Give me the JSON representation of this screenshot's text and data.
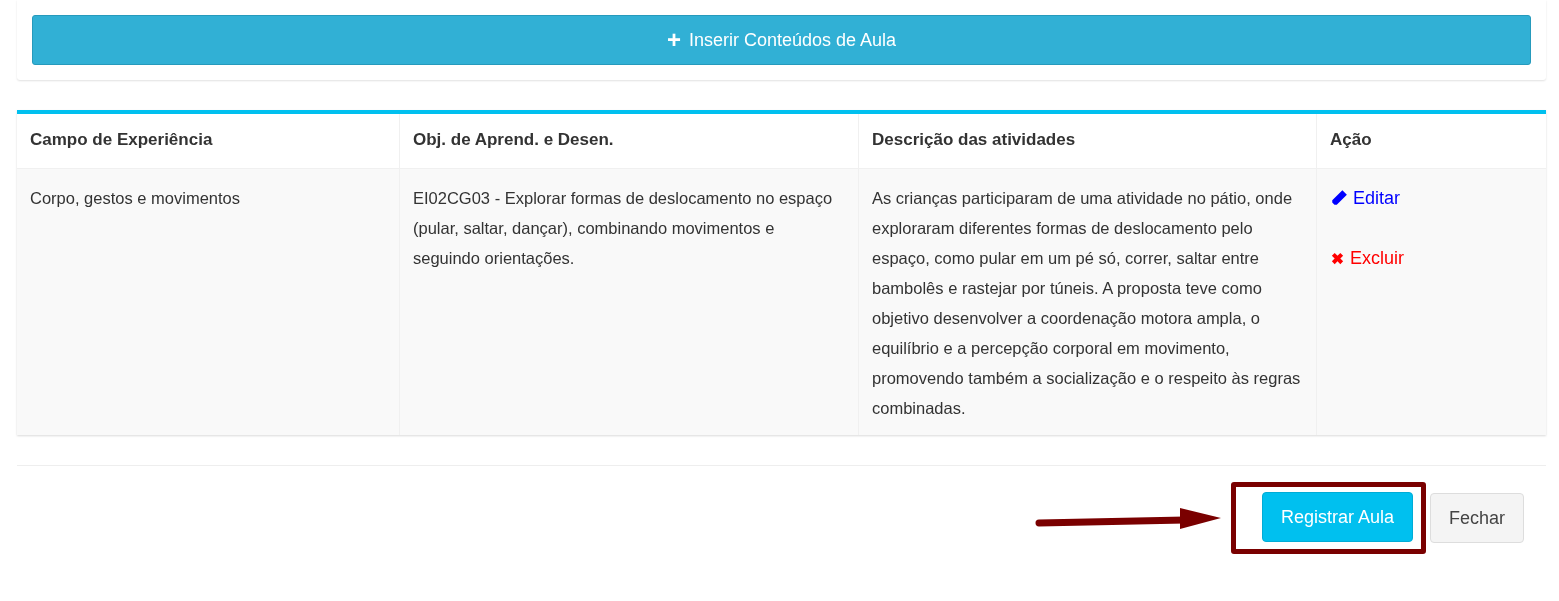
{
  "insert_button": {
    "icon": "+",
    "label": "Inserir Conteúdos de Aula"
  },
  "table": {
    "columns": [
      "Campo de Experiência",
      "Obj. de Aprend. e Desen.",
      "Descrição das atividades",
      "Ação"
    ],
    "rows": [
      {
        "cells": [
          "Corpo, gestos e movimentos",
          "EI02CG03 - Explorar formas de deslocamento no espaço (pular, saltar, dançar), combinando movimentos e seguindo orientações.",
          "As crianças participaram de uma atividade no pátio, onde exploraram diferentes formas de deslocamento pelo espaço, como pular em um pé só, correr, saltar entre bambolês e rastejar por túneis. A proposta teve como objetivo desenvolver a coordenação motora ampla, o equilíbrio e a percepção corporal em movimento, promovendo também a socialização e o respeito às regras combinadas."
        ],
        "actions": [
          {
            "kind": "edit",
            "label": "Editar"
          },
          {
            "kind": "delete",
            "label": "Excluir"
          }
        ]
      }
    ]
  },
  "footer": {
    "buttons": [
      {
        "kind": "primary",
        "label": "Registrar Aula",
        "highlighted": true
      },
      {
        "kind": "default",
        "label": "Fechar",
        "highlighted": false
      }
    ]
  }
}
